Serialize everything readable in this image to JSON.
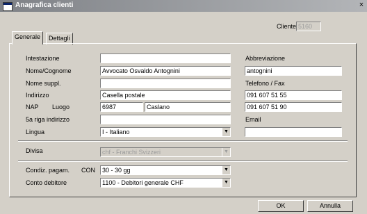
{
  "window": {
    "title": "Anagrafica clienti",
    "close_glyph": "×"
  },
  "header": {
    "cliente_label": "Cliente",
    "cliente_value": "5160"
  },
  "tabs": [
    {
      "label": "Generale"
    },
    {
      "label": "Dettagli"
    }
  ],
  "form": {
    "intestazione": {
      "label": "Intestazione",
      "value": ""
    },
    "nome_cognome": {
      "label": "Nome/Cognome",
      "value": "Avvocato Osvaldo Antognini"
    },
    "nome_suppl": {
      "label": "Nome suppl.",
      "value": ""
    },
    "indirizzo": {
      "label": "Indirizzo",
      "value": "Casella postale"
    },
    "nap": {
      "label": "NAP",
      "value": "6987"
    },
    "luogo": {
      "label": "Luogo",
      "value": "Caslano"
    },
    "riga5": {
      "label": "5a riga indirizzo",
      "value": ""
    },
    "lingua": {
      "label": "Lingua",
      "value": "I    - Italiano"
    },
    "abbreviazione": {
      "label": "Abbreviazione",
      "value": "antognini"
    },
    "telefono_fax": {
      "label": "Telefono / Fax",
      "telefono": "091 607 51 55",
      "fax": "091 607 51 90"
    },
    "email": {
      "label": "Email",
      "value": ""
    },
    "divisa": {
      "label": "Divisa",
      "value": "chf - Franchi Svizzeri"
    },
    "condiz_pagam": {
      "label": "Condiz. pagam.",
      "code": "CON",
      "value": "30 - 30 gg"
    },
    "conto_debitore": {
      "label": "Conto debitore",
      "value": "1100          - Debitori generale CHF"
    }
  },
  "buttons": {
    "ok": "OK",
    "annulla": "Annulla"
  },
  "icons": {
    "dropdown": "▼"
  }
}
